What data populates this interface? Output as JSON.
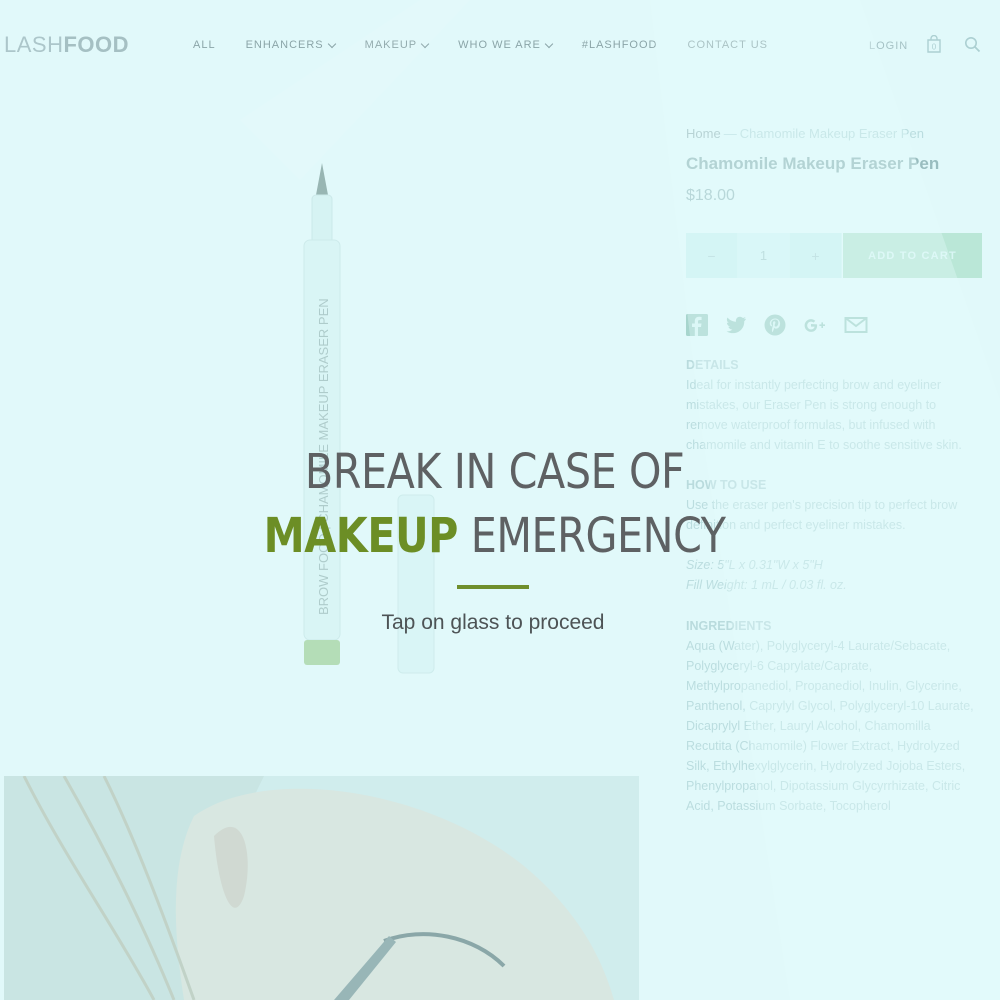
{
  "header": {
    "logo_light": "LASH",
    "logo_bold": "FOOD",
    "nav": [
      {
        "label": "ALL",
        "dropdown": false
      },
      {
        "label": "ENHANCERS",
        "dropdown": true
      },
      {
        "label": "MAKEUP",
        "dropdown": true
      },
      {
        "label": "WHO WE ARE",
        "dropdown": true
      },
      {
        "label": "#LASHFOOD",
        "dropdown": false
      },
      {
        "label": "CONTACT US",
        "dropdown": false
      }
    ],
    "login": "LOGIN",
    "cart_count": "0",
    "icons": {
      "cart": "shopping-bag-icon",
      "search": "search-icon"
    }
  },
  "product": {
    "breadcrumb_home": "Home",
    "breadcrumb_sep": "—",
    "breadcrumb_current": "Chamomile Makeup Eraser Pen",
    "title": "Chamomile Makeup Eraser Pen",
    "price": "$18.00",
    "qty_minus": "−",
    "qty_value": "1",
    "qty_plus": "+",
    "add_to_cart": "ADD TO CART",
    "pen_label": "BROW FOOD | CHAMOMILE MAKEUP ERASER PEN",
    "share_icons": [
      "facebook-icon",
      "twitter-icon",
      "pinterest-icon",
      "google-plus-icon",
      "email-icon"
    ],
    "details_heading": "DETAILS",
    "details_text": "Ideal for instantly perfecting brow and eyeliner mistakes, our Eraser Pen is strong enough to remove waterproof formulas, but infused with chamomile and vitamin E to soothe sensitive skin.",
    "howto_heading": "HOW TO USE",
    "howto_text": "Use the eraser pen's precision tip to perfect brow definition and perfect eyeliner mistakes.",
    "size": "Size: 5\"L x 0.31\"W x 5\"H",
    "fill_weight": "Fill Weight: 1 mL / 0.03 fl. oz.",
    "ingredients_heading": "INGREDIENTS",
    "ingredients_text": "Aqua (Water), Polyglyceryl-4 Laurate/Sebacate, Polyglyceryl-6 Caprylate/Caprate, Methylpropanediol, Propanediol, Inulin, Glycerine, Panthenol, Caprylyl Glycol, Polyglyceryl-10 Laurate, Dicaprylyl Ether, Lauryl Alcohol, Chamomilla Recutita (Chamomile) Flower Extract, Hydrolyzed Silk, Ethylhexylglycerin, Hydrolyzed Jojoba Esters, Phenylpropanol, Dipotassium Glycyrrhizate, Citric Acid, Potassium Sorbate, Tocopherol"
  },
  "overlay": {
    "line1": "BREAK IN CASE OF",
    "line2_highlight": "MAKEUP",
    "line2_rest": " EMERGENCY",
    "cta": "Tap on glass to proceed",
    "accent_color": "#6c8e25",
    "tint_color": "#c8f4f6"
  }
}
